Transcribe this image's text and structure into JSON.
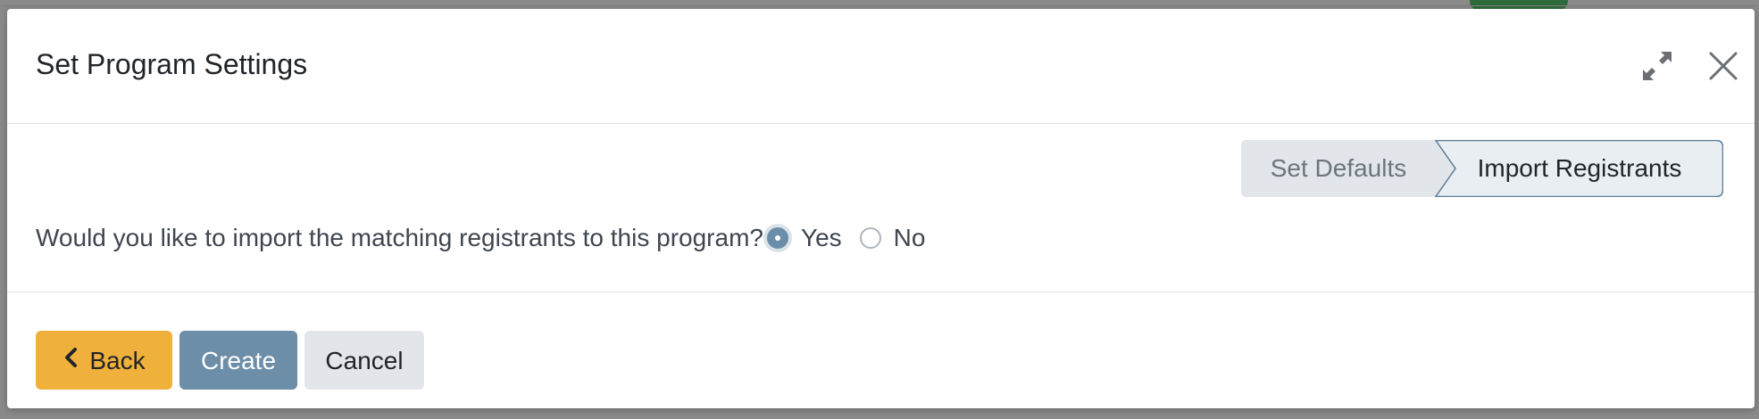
{
  "modal": {
    "title": "Set Program Settings",
    "icons": {
      "expand": "expand-arrows-icon",
      "close": "close-x-icon"
    }
  },
  "steps": [
    {
      "label": "Set Defaults",
      "active": false
    },
    {
      "label": "Import Registrants",
      "active": true
    }
  ],
  "question": {
    "text": "Would you like to import the matching registrants to this program?",
    "options": [
      {
        "label": "Yes",
        "checked": true
      },
      {
        "label": "No",
        "checked": false
      }
    ]
  },
  "footer": {
    "back_label": "Back",
    "create_label": "Create",
    "cancel_label": "Cancel"
  },
  "colors": {
    "primary": "#6c8ea8",
    "warning": "#f0b03c",
    "secondary": "#e2e6ea",
    "step_active_bg": "#e9eef2",
    "step_inactive_bg": "#e2e6ea"
  }
}
